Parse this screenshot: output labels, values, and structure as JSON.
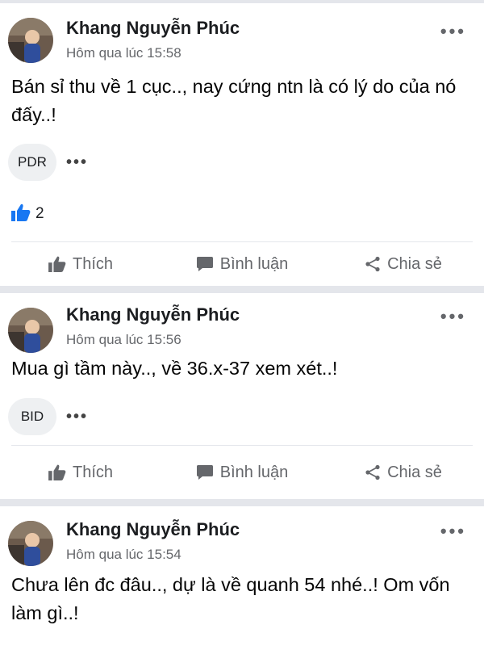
{
  "colors": {
    "accent": "#1877f2",
    "muted": "#65676b",
    "separator": "#e4e6eb"
  },
  "actions": {
    "like": "Thích",
    "comment": "Bình luận",
    "share": "Chia sẻ"
  },
  "posts": [
    {
      "author": "Khang Nguyễn Phúc",
      "time": "Hôm qua lúc 15:58",
      "text": "Bán sỉ thu về 1 cục.., nay cứng ntn là có lý do của nó đấy..!",
      "tag": "PDR",
      "likes": "2"
    },
    {
      "author": "Khang Nguyễn Phúc",
      "time": "Hôm qua lúc 15:56",
      "text": "Mua gì tầm này.., về 36.x-37 xem xét..!",
      "tag": "BID"
    },
    {
      "author": "Khang Nguyễn Phúc",
      "time": "Hôm qua lúc 15:54",
      "text": "Chưa lên đc đâu.., dự là về quanh 54 nhé..! Om vốn làm gì..!"
    }
  ]
}
